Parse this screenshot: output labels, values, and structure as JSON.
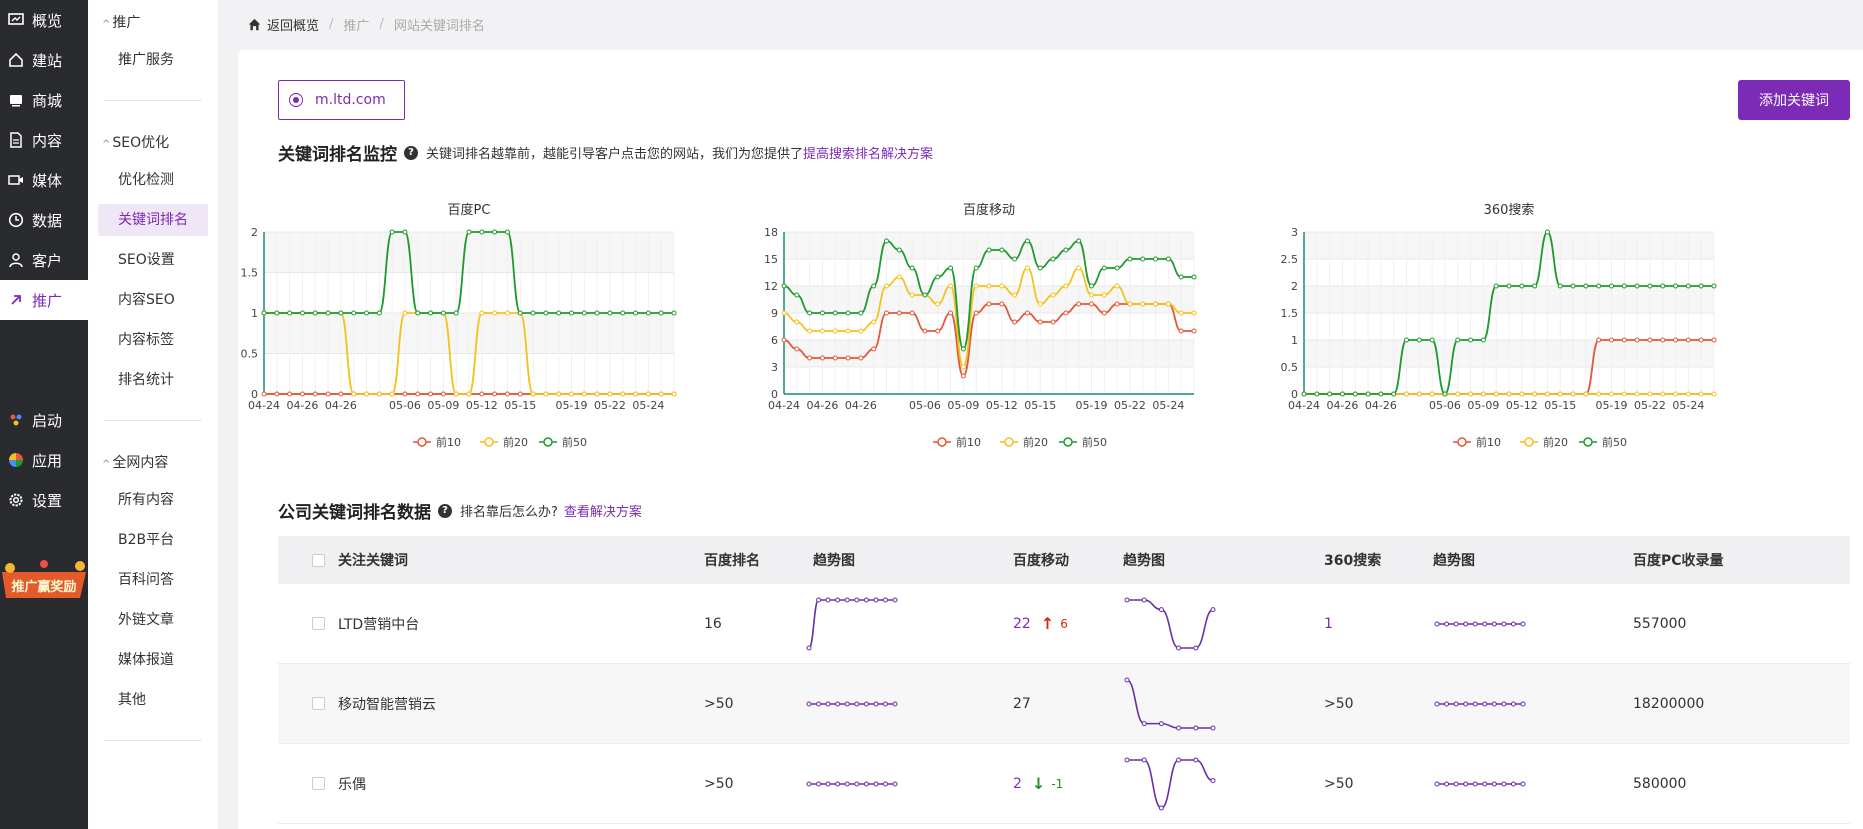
{
  "nav": {
    "items": [
      {
        "label": "概览",
        "icon": "dashboard-icon"
      },
      {
        "label": "建站",
        "icon": "home-icon"
      },
      {
        "label": "商城",
        "icon": "shop-icon"
      },
      {
        "label": "内容",
        "icon": "document-icon"
      },
      {
        "label": "媒体",
        "icon": "video-icon"
      },
      {
        "label": "数据",
        "icon": "clock-icon"
      },
      {
        "label": "客户",
        "icon": "user-icon"
      },
      {
        "label": "推广",
        "icon": "link-icon"
      },
      {
        "label": "启动",
        "icon": "launch-icon"
      },
      {
        "label": "应用",
        "icon": "apps-icon"
      },
      {
        "label": "设置",
        "icon": "gear-icon"
      }
    ],
    "promo": "推广赢奖励"
  },
  "sub": {
    "group1": "推广",
    "g1_items": [
      "推广服务"
    ],
    "group2": "SEO优化",
    "g2_items": [
      "优化检测",
      "关键词排名",
      "SEO设置",
      "内容SEO",
      "内容标签",
      "排名统计"
    ],
    "group3": "全网内容",
    "g3_items": [
      "所有内容",
      "B2B平台",
      "百科问答",
      "外链文章",
      "媒体报道",
      "其他"
    ]
  },
  "breadcrumb": {
    "home": "返回概览",
    "level1": "推广",
    "level2": "网站关键词排名"
  },
  "domain": "m.ltd.com",
  "add_button": "添加关键词",
  "monitor": {
    "title": "关键词排名监控",
    "desc": "关键词排名越靠前，越能引导客户点击您的网站，我们为您提供了",
    "link": "提高搜索排名解决方案"
  },
  "colors": {
    "accent": "#7b2bb5",
    "top10": "#e4573a",
    "top20": "#f4c21d",
    "top50": "#1f9a2e"
  },
  "chart_data": [
    {
      "type": "line",
      "title": "百度PC",
      "x": [
        "04-24",
        "04-25",
        "04-26",
        "04-27",
        "04-28",
        "04-29",
        "04-30",
        "05-01",
        "05-02",
        "05-03",
        "05-04",
        "05-05",
        "05-06",
        "05-07",
        "05-08",
        "05-09",
        "05-10",
        "05-11",
        "05-12",
        "05-13",
        "05-14",
        "05-15",
        "05-16",
        "05-17",
        "05-18",
        "05-19",
        "05-20",
        "05-21",
        "05-22",
        "05-23",
        "05-24",
        "05-25",
        "05-26"
      ],
      "xticks": [
        "04-24",
        "04-26",
        "04-26",
        "05-06",
        "05-09",
        "05-12",
        "05-15",
        "05-19",
        "05-22",
        "05-24"
      ],
      "yticks": [
        "0",
        "0.5",
        "1",
        "1.5",
        "2"
      ],
      "ylim": [
        0,
        2
      ],
      "series": [
        {
          "name": "前10",
          "values": [
            0,
            0,
            0,
            0,
            0,
            0,
            0,
            0,
            0,
            0,
            0,
            0,
            0,
            0,
            0,
            0,
            0,
            0,
            0,
            0,
            0,
            0,
            0,
            0,
            0,
            0,
            0,
            0,
            0,
            0,
            0,
            0,
            0
          ]
        },
        {
          "name": "前20",
          "values": [
            1,
            1,
            1,
            1,
            1,
            1,
            1,
            0,
            0,
            0,
            0,
            1,
            1,
            1,
            1,
            0,
            0,
            1,
            1,
            1,
            1,
            0,
            0,
            0,
            0,
            0,
            0,
            0,
            0,
            0,
            0,
            0,
            0
          ]
        },
        {
          "name": "前50",
          "values": [
            1,
            1,
            1,
            1,
            1,
            1,
            1,
            1,
            1,
            1,
            2,
            2,
            1,
            1,
            1,
            1,
            2,
            2,
            2,
            2,
            1,
            1,
            1,
            1,
            1,
            1,
            1,
            1,
            1,
            1,
            1,
            1,
            1
          ]
        }
      ]
    },
    {
      "type": "line",
      "title": "百度移动",
      "x": [
        "04-24",
        "04-25",
        "04-26",
        "04-27",
        "04-28",
        "04-29",
        "04-30",
        "05-01",
        "05-02",
        "05-03",
        "05-04",
        "05-05",
        "05-06",
        "05-07",
        "05-08",
        "05-09",
        "05-10",
        "05-11",
        "05-12",
        "05-13",
        "05-14",
        "05-15",
        "05-16",
        "05-17",
        "05-18",
        "05-19",
        "05-20",
        "05-21",
        "05-22",
        "05-23",
        "05-24",
        "05-25",
        "05-26"
      ],
      "xticks": [
        "04-24",
        "04-26",
        "04-26",
        "05-06",
        "05-09",
        "05-12",
        "05-15",
        "05-19",
        "05-22",
        "05-24"
      ],
      "yticks": [
        "0",
        "3",
        "6",
        "9",
        "12",
        "15",
        "18"
      ],
      "ylim": [
        0,
        18
      ],
      "series": [
        {
          "name": "前10",
          "values": [
            6,
            5,
            4,
            4,
            4,
            4,
            4,
            5,
            9,
            9,
            9,
            7,
            7,
            9,
            2,
            9,
            10,
            10,
            8,
            9,
            8,
            8,
            9,
            10,
            10,
            9,
            10,
            10,
            10,
            10,
            10,
            7,
            7
          ]
        },
        {
          "name": "前20",
          "values": [
            9,
            8,
            7,
            7,
            7,
            7,
            7,
            8,
            12,
            13,
            11,
            11,
            10,
            12,
            3,
            12,
            12,
            12,
            11,
            14,
            10,
            11,
            12,
            14,
            11,
            11,
            12,
            10,
            10,
            10,
            10,
            9,
            9
          ]
        },
        {
          "name": "前50",
          "values": [
            12,
            11,
            9,
            9,
            9,
            9,
            9,
            12,
            17,
            16,
            14,
            11,
            13,
            14,
            5,
            14,
            16,
            16,
            15,
            17,
            14,
            15,
            16,
            17,
            12,
            14,
            14,
            15,
            15,
            15,
            15,
            13,
            13
          ]
        }
      ]
    },
    {
      "type": "line",
      "title": "360搜索",
      "x": [
        "04-24",
        "04-25",
        "04-26",
        "04-27",
        "04-28",
        "04-29",
        "04-30",
        "05-01",
        "05-02",
        "05-03",
        "05-04",
        "05-05",
        "05-06",
        "05-07",
        "05-08",
        "05-09",
        "05-10",
        "05-11",
        "05-12",
        "05-13",
        "05-14",
        "05-15",
        "05-16",
        "05-17",
        "05-18",
        "05-19",
        "05-20",
        "05-21",
        "05-22",
        "05-23",
        "05-24",
        "05-25",
        "05-26"
      ],
      "xticks": [
        "04-24",
        "04-26",
        "04-26",
        "05-06",
        "05-09",
        "05-12",
        "05-15",
        "05-19",
        "05-22",
        "05-24"
      ],
      "yticks": [
        "0",
        "0.5",
        "1",
        "1.5",
        "2",
        "2.5",
        "3"
      ],
      "ylim": [
        0,
        3
      ],
      "series": [
        {
          "name": "前10",
          "values": [
            0,
            0,
            0,
            0,
            0,
            0,
            0,
            0,
            0,
            0,
            0,
            0,
            0,
            0,
            0,
            0,
            0,
            0,
            0,
            0,
            0,
            0,
            0,
            1,
            1,
            1,
            1,
            1,
            1,
            1,
            1,
            1,
            1
          ]
        },
        {
          "name": "前20",
          "values": [
            0,
            0,
            0,
            0,
            0,
            0,
            0,
            0,
            0,
            0,
            0,
            0,
            0,
            0,
            0,
            0,
            0,
            0,
            0,
            0,
            0,
            0,
            0,
            0,
            0,
            0,
            0,
            0,
            0,
            0,
            0,
            0,
            0
          ]
        },
        {
          "name": "前50",
          "values": [
            0,
            0,
            0,
            0,
            0,
            0,
            0,
            0,
            1,
            1,
            1,
            0,
            1,
            1,
            1,
            2,
            2,
            2,
            2,
            3,
            2,
            2,
            2,
            2,
            2,
            2,
            2,
            2,
            2,
            2,
            2,
            2,
            2
          ]
        }
      ]
    }
  ],
  "company": {
    "title": "公司关键词排名数据",
    "desc": "排名靠后怎么办?",
    "link": "查看解决方案"
  },
  "table": {
    "headers": [
      "关注关键词",
      "百度排名",
      "趋势图",
      "百度移动",
      "趋势图",
      "360搜索",
      "趋势图",
      "百度PC收录量"
    ],
    "rows": [
      {
        "keyword": "LTD营销中台",
        "baidu": "16",
        "mobile": "22",
        "mobile_change": "6",
        "mobile_dir": "up",
        "s360": "1",
        "index": "557000",
        "spark1": [
          20,
          1,
          1,
          1,
          1,
          1,
          1,
          1,
          1,
          1
        ],
        "spark2": [
          2,
          2,
          4,
          12,
          12,
          4
        ],
        "spark3": [
          1,
          1,
          1,
          1,
          1,
          1,
          1,
          1,
          1,
          1
        ]
      },
      {
        "keyword": "移动智能营销云",
        "baidu": ">50",
        "mobile": "27",
        "mobile_change": "",
        "mobile_dir": "",
        "s360": ">50",
        "index": "18200000",
        "spark1": [
          1,
          1,
          1,
          1,
          1,
          1,
          1,
          1,
          1,
          1
        ],
        "spark2": [
          1,
          11,
          11,
          12,
          12,
          12
        ],
        "spark3": [
          1,
          1,
          1,
          1,
          1,
          1,
          1,
          1,
          1,
          1
        ]
      },
      {
        "keyword": "乐偶",
        "baidu": ">50",
        "mobile": "2",
        "mobile_change": "-1",
        "mobile_dir": "down",
        "s360": ">50",
        "index": "580000",
        "spark1": [
          1,
          1,
          1,
          1,
          1,
          1,
          1,
          1,
          1,
          1
        ],
        "spark2": [
          1,
          1,
          8,
          1,
          1,
          4
        ],
        "spark3": [
          1,
          1,
          1,
          1,
          1,
          1,
          1,
          1,
          1,
          1
        ]
      }
    ]
  }
}
